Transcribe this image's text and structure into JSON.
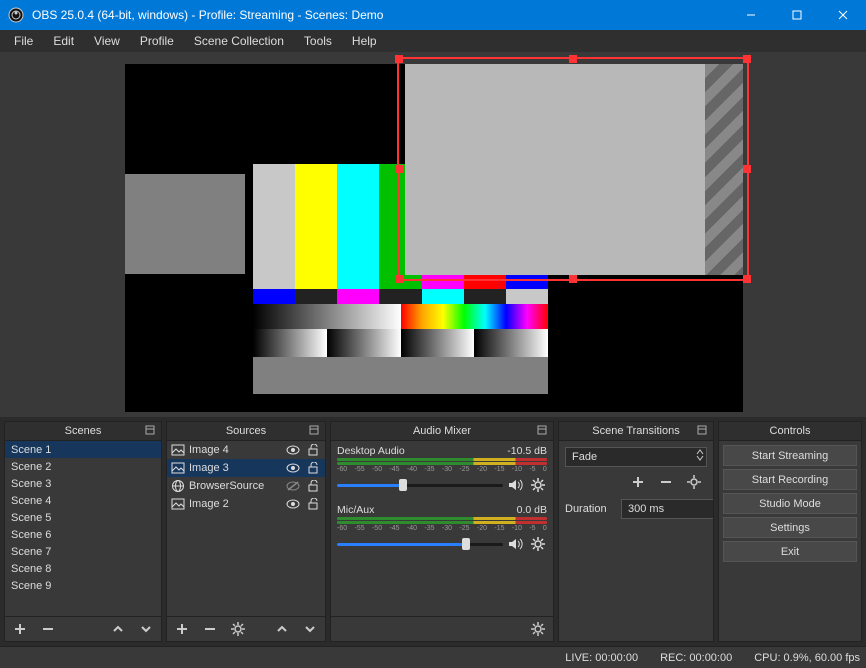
{
  "titlebar": {
    "title": "OBS 25.0.4 (64-bit, windows) - Profile: Streaming - Scenes: Demo"
  },
  "menu": [
    "File",
    "Edit",
    "View",
    "Profile",
    "Scene Collection",
    "Tools",
    "Help"
  ],
  "scenes": {
    "title": "Scenes",
    "items": [
      "Scene 1",
      "Scene 2",
      "Scene 3",
      "Scene 4",
      "Scene 5",
      "Scene 6",
      "Scene 7",
      "Scene 8",
      "Scene 9"
    ],
    "selected": 0
  },
  "sources": {
    "title": "Sources",
    "items": [
      {
        "name": "Image 4",
        "icon": "image",
        "eye": true,
        "lock": false,
        "sel": false
      },
      {
        "name": "Image 3",
        "icon": "image",
        "eye": true,
        "lock": false,
        "sel": true
      },
      {
        "name": "BrowserSource",
        "icon": "globe",
        "eye": false,
        "lock": false,
        "sel": false
      },
      {
        "name": "Image 2",
        "icon": "image",
        "eye": true,
        "lock": false,
        "sel": false
      }
    ]
  },
  "mixer": {
    "title": "Audio Mixer",
    "ticks": [
      "-60",
      "-55",
      "-50",
      "-45",
      "-40",
      "-35",
      "-30",
      "-25",
      "-20",
      "-15",
      "-10",
      "-5",
      "0"
    ],
    "channels": [
      {
        "name": "Desktop Audio",
        "db": "-10.5 dB",
        "fill": 40
      },
      {
        "name": "Mic/Aux",
        "db": "0.0 dB",
        "fill": 78
      }
    ]
  },
  "transitions": {
    "title": "Scene Transitions",
    "type": "Fade",
    "duration_label": "Duration",
    "duration": "300 ms"
  },
  "controls": {
    "title": "Controls",
    "buttons": [
      "Start Streaming",
      "Start Recording",
      "Studio Mode",
      "Settings",
      "Exit"
    ]
  },
  "status": {
    "live": "LIVE: 00:00:00",
    "rec": "REC: 00:00:00",
    "cpu": "CPU: 0.9%, 60.00 fps"
  }
}
